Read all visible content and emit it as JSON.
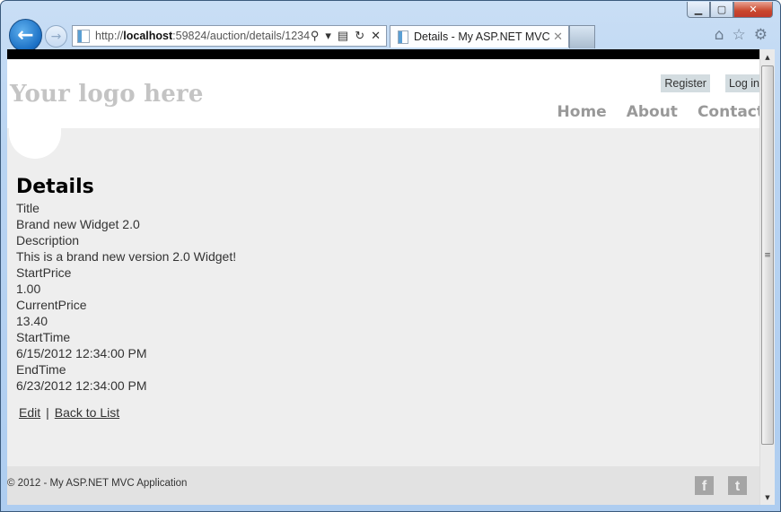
{
  "browser": {
    "url_prefix": "http://",
    "url_host": "localhost",
    "url_rest": ":59824/auction/details/1234",
    "tab_title": "Details - My ASP.NET MVC ...",
    "icons": {
      "back": "←",
      "forward": "→",
      "search": "⚲",
      "dropdown": "▾",
      "compat": "▤",
      "refresh": "↻",
      "stop": "✕",
      "tab_close": "✕",
      "home": "⌂",
      "favorites": "☆",
      "tools": "⚙",
      "minimize": "▁",
      "maximize": "▢",
      "close": "✕"
    }
  },
  "site": {
    "logo": "Your logo here",
    "login_links": [
      {
        "label": "Register"
      },
      {
        "label": "Log in"
      }
    ],
    "menu": [
      {
        "label": "Home"
      },
      {
        "label": "About"
      },
      {
        "label": "Contact"
      }
    ]
  },
  "main": {
    "heading": "Details",
    "fields": [
      {
        "label": "Title",
        "value": "Brand new Widget 2.0"
      },
      {
        "label": "Description",
        "value": "This is a brand new version 2.0 Widget!"
      },
      {
        "label": "StartPrice",
        "value": "1.00"
      },
      {
        "label": "CurrentPrice",
        "value": "13.40"
      },
      {
        "label": "StartTime",
        "value": "6/15/2012 12:34:00 PM"
      },
      {
        "label": "EndTime",
        "value": "6/23/2012 12:34:00 PM"
      }
    ],
    "actions": {
      "edit": "Edit",
      "separator": "|",
      "back": "Back to List"
    }
  },
  "footer": {
    "copyright": "© 2012 - My ASP.NET MVC Application",
    "social": [
      {
        "name": "facebook",
        "glyph": "f"
      },
      {
        "name": "twitter",
        "glyph": "t"
      }
    ]
  },
  "scrollbar": {
    "up": "▲",
    "down": "▼",
    "grip": "≡"
  }
}
